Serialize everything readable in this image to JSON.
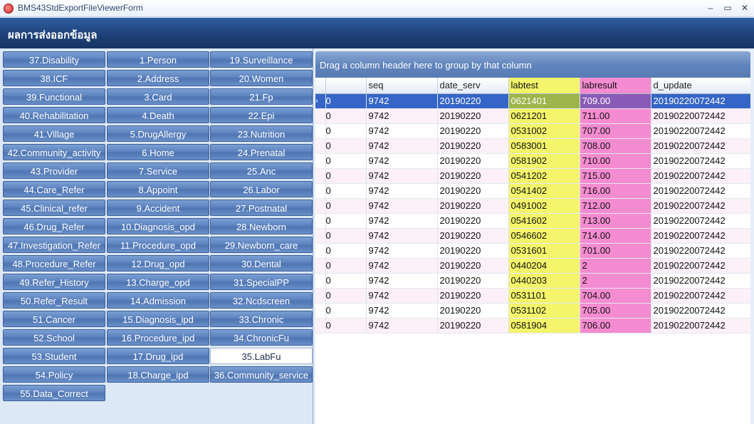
{
  "window": {
    "title": "BMS43StdExportFileViewerForm",
    "minimize": "–",
    "maximize": "▭",
    "close": "✕"
  },
  "header": {
    "title": "ผลการส่งออกข้อมูล"
  },
  "nav": {
    "col1": [
      "37.Disability",
      "38.ICF",
      "39.Functional",
      "40.Rehabilitation",
      "41.Village",
      "42.Community_activity",
      "43.Provider",
      "44.Care_Refer",
      "45.Clinical_refer",
      "46.Drug_Refer",
      "47.Investigation_Refer",
      "48.Procedure_Refer",
      "49.Refer_History",
      "50.Refer_Result",
      "51.Cancer",
      "52.School",
      "53.Student",
      "54.Policy",
      "55.Data_Correct"
    ],
    "col2": [
      "1.Person",
      "2.Address",
      "3.Card",
      "4.Death",
      "5.DrugAllergy",
      "6.Home",
      "7.Service",
      "8.Appoint",
      "9.Accident",
      "10.Diagnosis_opd",
      "11.Procedure_opd",
      "12.Drug_opd",
      "13.Charge_opd",
      "14.Admission",
      "15.Diagnosis_ipd",
      "16.Procedure_ipd",
      "17.Drug_ipd",
      "18.Charge_ipd"
    ],
    "col3": [
      "19.Surveillance",
      "20.Women",
      "21.Fp",
      "22.Epi",
      "23.Nutrition",
      "24.Prenatal",
      "25.Anc",
      "26.Labor",
      "27.Postnatal",
      "28.Newborn",
      "29.Newborn_care",
      "30.Dental",
      "31.SpecialPP",
      "32.Ncdscreen",
      "33.Chronic",
      "34.ChronicFu",
      "35.LabFu",
      "36.Community_service"
    ],
    "active": "35.LabFu"
  },
  "grid": {
    "group_hint": "Drag a column header here to group by that column",
    "columns": [
      "seq",
      "date_serv",
      "labtest",
      "labresult",
      "d_update"
    ],
    "row_indicator": "›",
    "first_col_value": "0",
    "rows": [
      [
        "9742",
        "20190220",
        "0621401",
        "709.00",
        "20190220072442"
      ],
      [
        "9742",
        "20190220",
        "0621201",
        "711.00",
        "20190220072442"
      ],
      [
        "9742",
        "20190220",
        "0531002",
        "707.00",
        "20190220072442"
      ],
      [
        "9742",
        "20190220",
        "0583001",
        "708.00",
        "20190220072442"
      ],
      [
        "9742",
        "20190220",
        "0581902",
        "710.00",
        "20190220072442"
      ],
      [
        "9742",
        "20190220",
        "0541202",
        "715.00",
        "20190220072442"
      ],
      [
        "9742",
        "20190220",
        "0541402",
        "716.00",
        "20190220072442"
      ],
      [
        "9742",
        "20190220",
        "0491002",
        "712.00",
        "20190220072442"
      ],
      [
        "9742",
        "20190220",
        "0541602",
        "713.00",
        "20190220072442"
      ],
      [
        "9742",
        "20190220",
        "0546602",
        "714.00",
        "20190220072442"
      ],
      [
        "9742",
        "20190220",
        "0531601",
        "701.00",
        "20190220072442"
      ],
      [
        "9742",
        "20190220",
        "0440204",
        "2",
        "20190220072442"
      ],
      [
        "9742",
        "20190220",
        "0440203",
        "2",
        "20190220072442"
      ],
      [
        "9742",
        "20190220",
        "0531101",
        "704.00",
        "20190220072442"
      ],
      [
        "9742",
        "20190220",
        "0531102",
        "705.00",
        "20190220072442"
      ],
      [
        "9742",
        "20190220",
        "0581904",
        "706.00",
        "20190220072442"
      ]
    ]
  },
  "colors": {
    "highlight_labtest": "#f4f56a",
    "highlight_labresult": "#f58bd0",
    "selected_row": "#3565c6"
  }
}
